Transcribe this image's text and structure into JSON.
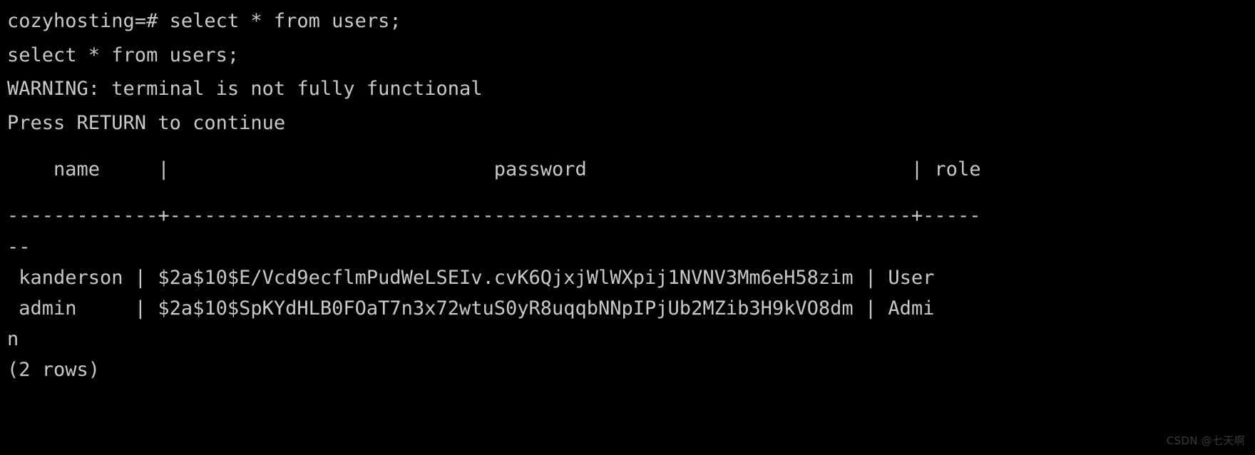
{
  "terminal": {
    "prompt_line": "cozyhosting=# select * from users;",
    "echo_line": "select * from users;",
    "warning_line": "WARNING: terminal is not fully functional",
    "press_return_line": "Press RETURN to continue",
    "blank_line": " ",
    "table": {
      "header_line": "    name     |                            password                            | role",
      "separator_line": "-------------+----------------------------------------------------------------+-----",
      "separator_wrap": "--",
      "rows": [
        {
          "line": " kanderson | $2a$10$E/Vcd9ecflmPudWeLSEIv.cvK6QjxjWlWXpij1NVNV3Mm6eH58zim | User",
          "name": "kanderson",
          "password": "$2a$10$E/Vcd9ecflmPudWeLSEIv.cvK6QjxjWlWXpij1NVNV3Mm6eH58zim",
          "role": "User"
        },
        {
          "line": " admin     | $2a$10$SpKYdHLB0FOaT7n3x72wtuS0yR8uqqbNNpIPjUb2MZib3H9kVO8dm | Admi",
          "name": "admin",
          "password": "$2a$10$SpKYdHLB0FOaT7n3x72wtuS0yR8uqqbNNpIPjUb2MZib3H9kVO8dm",
          "role": "Admin"
        }
      ],
      "row_wrap": "n",
      "row_count_line": "(2 rows)"
    }
  },
  "watermark": {
    "text": "CSDN @七天啊"
  },
  "colors": {
    "background": "#000000",
    "foreground": "#c8c8c8",
    "watermark": "#3a3a3a"
  }
}
